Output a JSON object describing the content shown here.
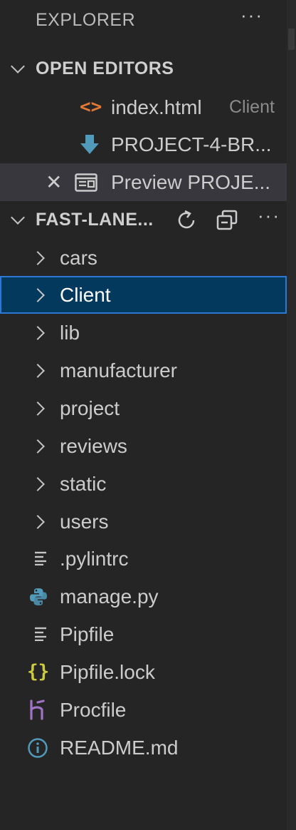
{
  "header": {
    "title": "EXPLORER",
    "more": "···"
  },
  "open_editors": {
    "label": "OPEN EDITORS",
    "items": [
      {
        "label": "index.html",
        "description": "Client",
        "icon": "html-file-icon"
      },
      {
        "label": "PROJECT-4-BR...",
        "icon": "markdown-down-arrow-icon"
      },
      {
        "label": "Preview PROJE...",
        "icon": "preview-icon",
        "active": true
      }
    ]
  },
  "workspace": {
    "label": "FAST-LANE...",
    "more": "···",
    "folders": [
      "cars",
      "Client",
      "lib",
      "manufacturer",
      "project",
      "reviews",
      "static",
      "users"
    ],
    "files": [
      {
        "name": ".pylintrc",
        "icon": "lines-icon"
      },
      {
        "name": "manage.py",
        "icon": "python-icon"
      },
      {
        "name": "Pipfile",
        "icon": "lines-icon"
      },
      {
        "name": "Pipfile.lock",
        "icon": "json-braces-icon"
      },
      {
        "name": "Procfile",
        "icon": "heroku-icon"
      },
      {
        "name": "README.md",
        "icon": "info-icon"
      }
    ],
    "selected": "Client"
  },
  "colors": {
    "background": "#252526",
    "selection": "#04395e",
    "selection_border": "#2b79d4",
    "html_icon": "#e37933",
    "markdown_icon": "#519aba",
    "python_icon": "#519aba",
    "json_icon": "#cbcb41",
    "heroku_icon": "#a074c4",
    "info_icon": "#519aba"
  }
}
